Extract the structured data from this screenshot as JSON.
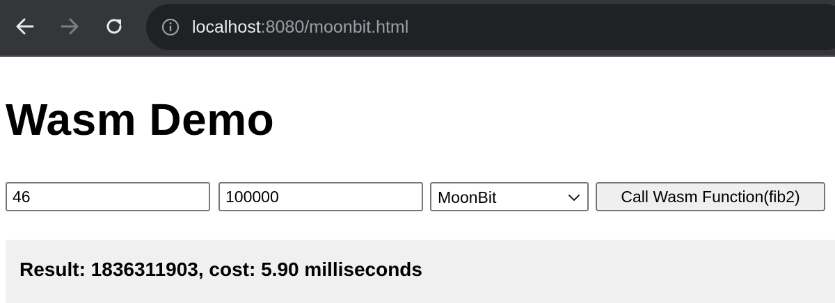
{
  "browser": {
    "url_host": "localhost",
    "url_rest": ":8080/moonbit.html",
    "icons": {
      "back": "arrow-left-icon",
      "forward": "arrow-right-icon",
      "reload": "reload-icon",
      "info": "info-icon"
    },
    "colors": {
      "toolbar": "#35363a",
      "omnibox": "#202124",
      "url_host": "#e8eaed",
      "url_rest": "#9aa0a6"
    }
  },
  "page": {
    "title": "Wasm Demo",
    "inputs": {
      "n_value": "46",
      "iterations_value": "100000"
    },
    "language_select": {
      "selected": "MoonBit"
    },
    "call_button_label": "Call Wasm Function(fib2)",
    "result_text": "Result: 1836311903, cost: 5.90 milliseconds",
    "colors": {
      "result_background": "#f0f0f0",
      "button_background": "#efefef"
    }
  }
}
